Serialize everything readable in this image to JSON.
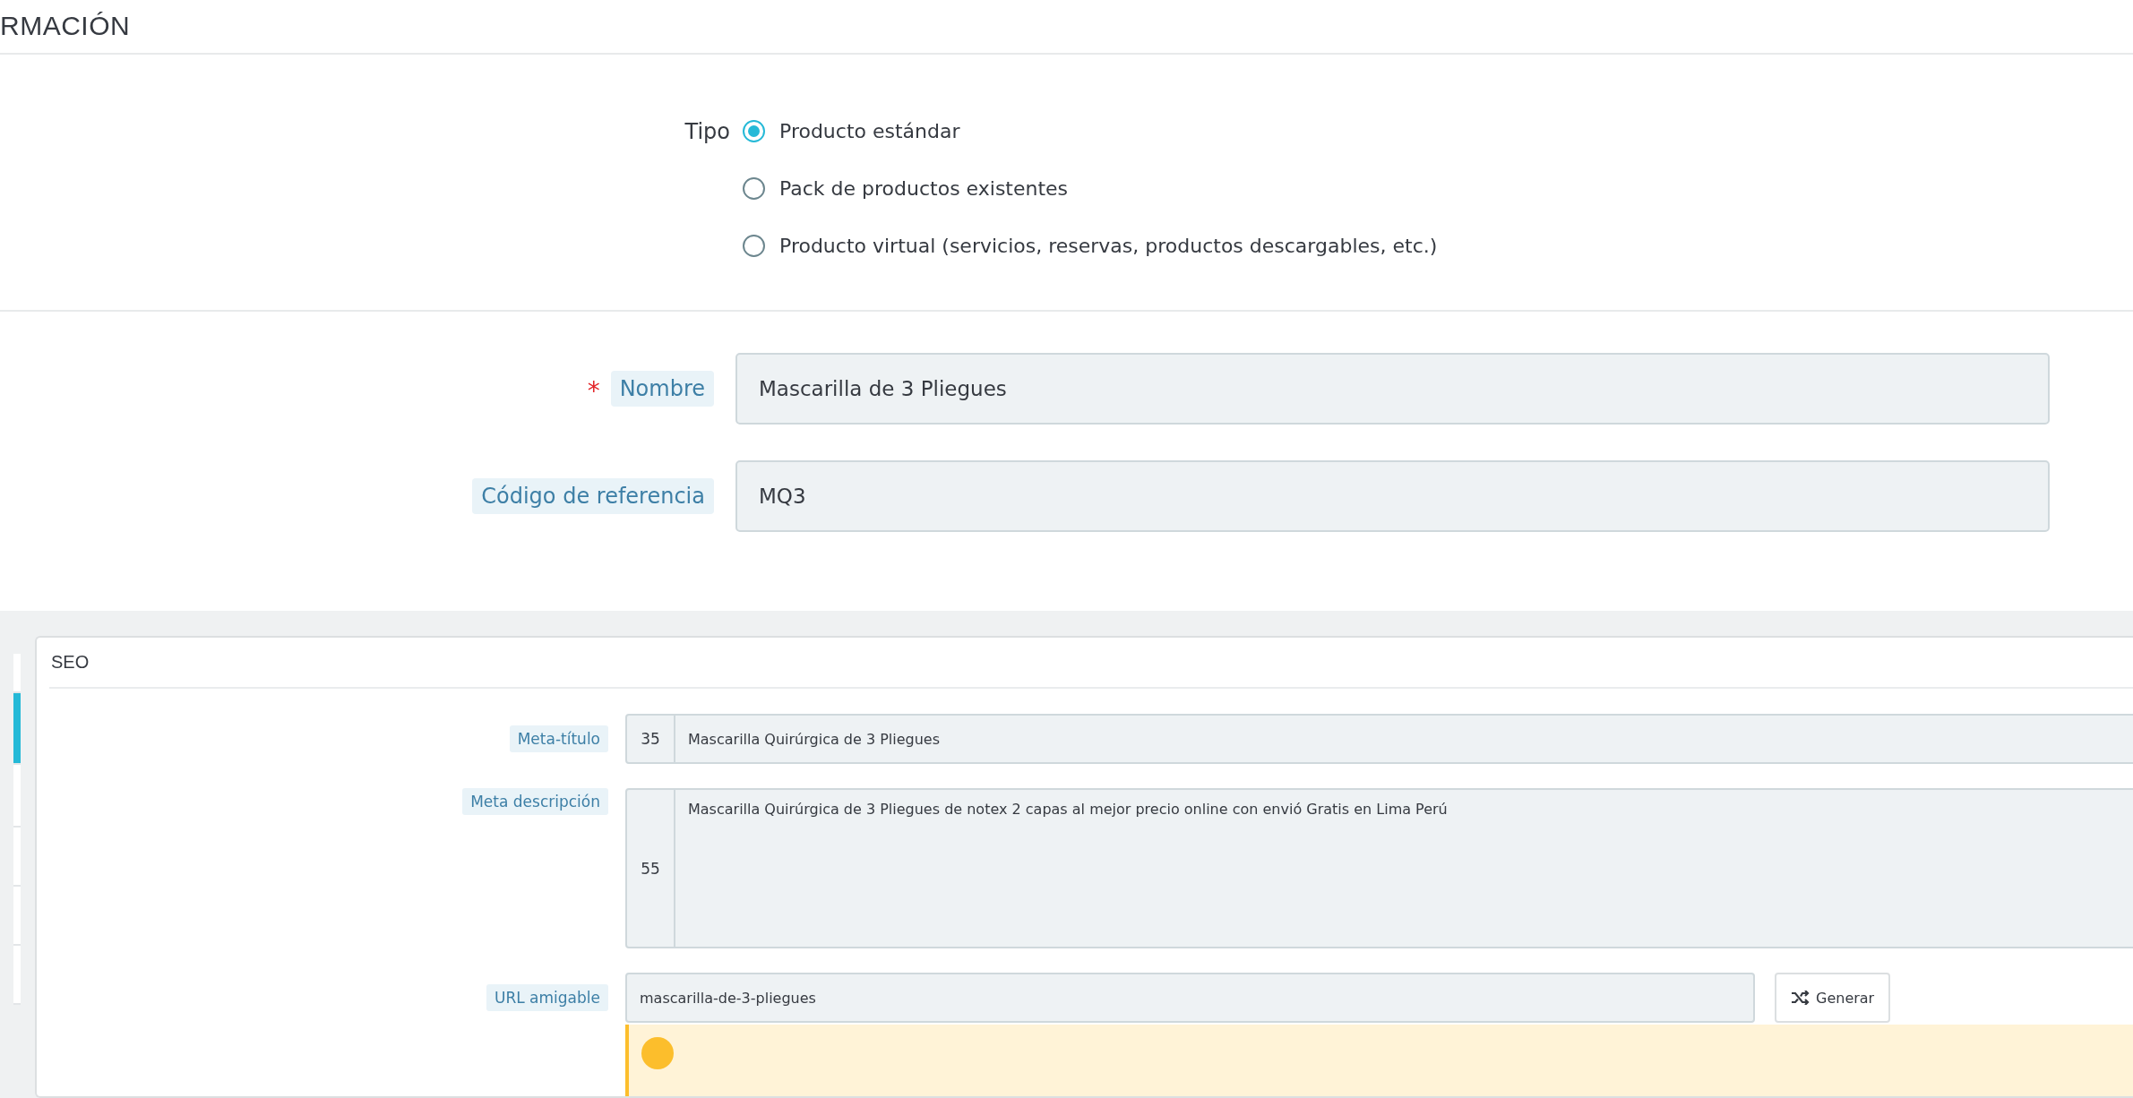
{
  "section_title": "RMACIÓN",
  "type_field": {
    "label": "Tipo",
    "options": [
      {
        "label": "Producto estándar",
        "selected": true
      },
      {
        "label": "Pack de productos existentes",
        "selected": false
      },
      {
        "label": "Producto virtual (servicios, reservas, productos descargables, etc.)",
        "selected": false
      }
    ]
  },
  "fields": [
    {
      "required_mark": "*",
      "label": "Nombre",
      "value": "Mascarilla de 3 Pliegues"
    },
    {
      "label": "Código de referencia",
      "value": "MQ3"
    }
  ],
  "sidebar_tabs": [
    {
      "selected": false
    },
    {
      "selected": true
    },
    {
      "selected": false
    },
    {
      "selected": false
    },
    {
      "selected": false
    },
    {
      "selected": false
    }
  ],
  "seo": {
    "title": "SEO",
    "meta_title": {
      "label": "Meta-título",
      "counter": "35",
      "value": "Mascarilla Quirúrgica de 3 Pliegues"
    },
    "meta_description": {
      "label": "Meta descripción",
      "counter": "55",
      "value": "Mascarilla Quirúrgica de 3 Pliegues de notex 2 capas al mejor precio online con envió Gratis en Lima Perú"
    },
    "friendly_url": {
      "label": "URL amigable",
      "value": "mascarilla-de-3-pliegues",
      "button": "Generar"
    }
  }
}
